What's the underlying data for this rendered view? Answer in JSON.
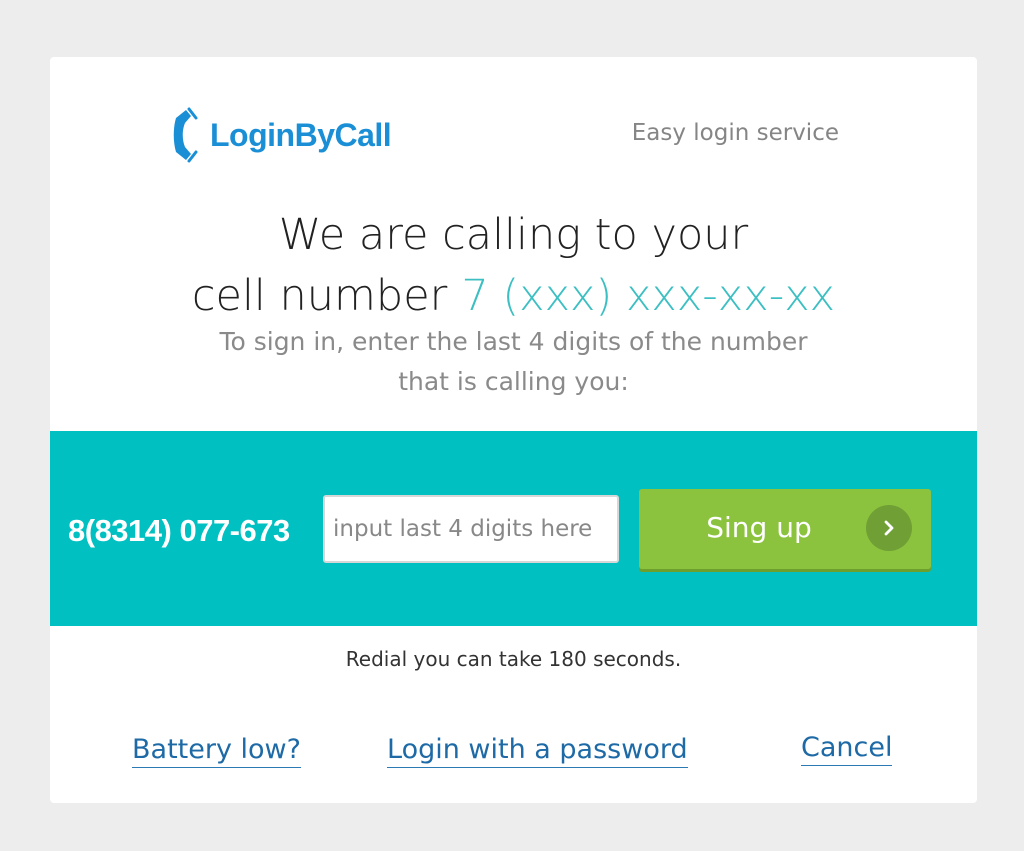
{
  "header": {
    "logo_text": "LoginByCall",
    "tagline": "Easy login service"
  },
  "main": {
    "heading_line1": "We are calling to your",
    "heading_line2": "cell number",
    "phone_mask": "7 (xxx) xxx-xx-xx",
    "instruction_line1": "To sign in, enter the last 4 digits of the number",
    "instruction_line2": "that is calling you:"
  },
  "form": {
    "caller_number": "8(8314) 077-673",
    "code_placeholder": "input last 4 digits here",
    "code_value": "",
    "submit_label": "Sing up"
  },
  "footer": {
    "redial_text": "Redial you can take 180 seconds.",
    "links": {
      "battery": "Battery low?",
      "password": "Login with a password",
      "cancel": "Cancel"
    }
  },
  "colors": {
    "brand_blue": "#1b8fd6",
    "accent_teal": "#00c0c2",
    "button_green": "#8cc33e",
    "link_blue": "#1d6aa6"
  },
  "icons": [
    "phone-handset-icon",
    "chevron-right-icon"
  ]
}
